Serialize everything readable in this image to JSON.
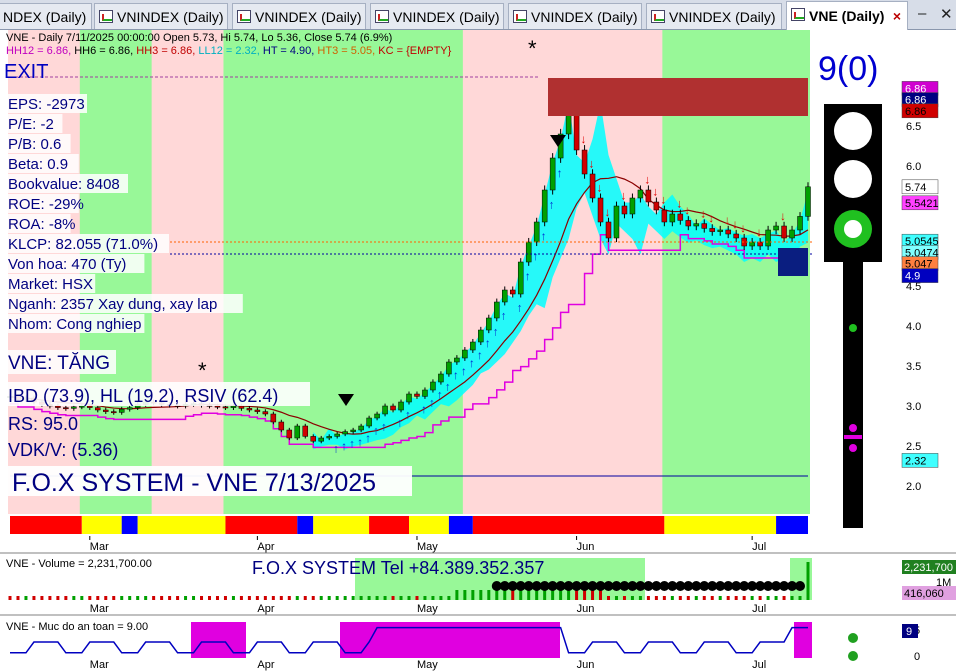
{
  "tabs": [
    {
      "label": "NDEX (Daily)"
    },
    {
      "label": "VNINDEX (Daily)"
    },
    {
      "label": "VNINDEX (Daily)"
    },
    {
      "label": "VNINDEX (Daily)"
    },
    {
      "label": "VNINDEX (Daily)"
    },
    {
      "label": "VNINDEX (Daily)"
    },
    {
      "label": "VNE (Daily)",
      "active": true
    }
  ],
  "header": {
    "line1": "VNE - Daily 7/11/2025 00:00:00 Open 5.73, Hi 5.74, Lo 5.36, Close 5.74 (6.9%)",
    "line2": [
      {
        "text": "HH12 = 6.86, ",
        "color": "#c000c0"
      },
      {
        "text": "HH6 = 6.86, ",
        "color": "#000000"
      },
      {
        "text": "HH3 = 6.86, ",
        "color": "#c00000"
      },
      {
        "text": "LL12 = 2.32, ",
        "color": "#00b0c0"
      },
      {
        "text": "HT = 4.90, ",
        "color": "#000080"
      },
      {
        "text": "HT3 = 5.05, ",
        "color": "#d06000"
      },
      {
        "text": "KC = {EMPTY}",
        "color": "#c00000"
      }
    ]
  },
  "overlay": {
    "exit": "EXIT",
    "fundamentals": [
      "EPS: -2973",
      "P/E: -2",
      "P/B: 0.6",
      "Beta: 0.9",
      "Bookvalue: 8408",
      "ROE: -29%",
      "ROA: -8%",
      "KLCP: 82.055 (71.0%)",
      "Von hoa: 470 (Ty)",
      "Market: HSX",
      "Nganh: 2357 Xay dung, xay lap",
      "Nhom: Cong nghiep"
    ],
    "trend": "VNE: TĂNG",
    "ratings": "IBD (73.9), HL (19.2), RSIV (62.4)",
    "rs": "RS: 95.0",
    "vdk": "VDK/V:  (5.36)",
    "banner": "F.O.X SYSTEM - VNE 7/13/2025",
    "signal": "9(0)",
    "vol_banner": "F.O.X SYSTEM Tel +84.389.352.357"
  },
  "chart_data": [
    {
      "type": "candlestick",
      "name": "VNE",
      "x": [
        "Feb 17",
        "Feb 18",
        "Feb 19",
        "Feb 20",
        "Feb 21",
        "Feb 24",
        "Feb 25",
        "Feb 26",
        "Feb 27",
        "Feb 28",
        "Mar 3",
        "Mar 4",
        "Mar 5",
        "Mar 6",
        "Mar 7",
        "Mar 10",
        "Mar 11",
        "Mar 12",
        "Mar 13",
        "Mar 14",
        "Mar 17",
        "Mar 18",
        "Mar 19",
        "Mar 20",
        "Mar 21",
        "Mar 24",
        "Mar 25",
        "Mar 26",
        "Mar 27",
        "Mar 28",
        "Mar 31",
        "Apr 1",
        "Apr 2",
        "Apr 3",
        "Apr 4",
        "Apr 8",
        "Apr 9",
        "Apr 10",
        "Apr 11",
        "Apr 14",
        "Apr 15",
        "Apr 16",
        "Apr 17",
        "Apr 18",
        "Apr 21",
        "Apr 22",
        "Apr 23",
        "Apr 24",
        "Apr 25",
        "Apr 28",
        "Apr 29",
        "May 5",
        "May 6",
        "May 7",
        "May 8",
        "May 9",
        "May 12",
        "May 13",
        "May 14",
        "May 15",
        "May 16",
        "May 19",
        "May 20",
        "May 21",
        "May 22",
        "May 23",
        "May 26",
        "May 27",
        "May 28",
        "May 29",
        "May 30",
        "Jun 2",
        "Jun 3",
        "Jun 4",
        "Jun 5",
        "Jun 6",
        "Jun 9",
        "Jun 10",
        "Jun 11",
        "Jun 12",
        "Jun 13",
        "Jun 16",
        "Jun 17",
        "Jun 18",
        "Jun 19",
        "Jun 20",
        "Jun 23",
        "Jun 24",
        "Jun 25",
        "Jun 26",
        "Jun 27",
        "Jun 30",
        "Jul 1",
        "Jul 2",
        "Jul 3",
        "Jul 4",
        "Jul 7",
        "Jul 8",
        "Jul 9",
        "Jul 10",
        "Jul 11"
      ],
      "close": [
        3.12,
        3.08,
        3.1,
        3.05,
        3.02,
        3.0,
        2.98,
        2.97,
        2.99,
        3.0,
        2.98,
        2.95,
        2.93,
        2.92,
        2.96,
        2.98,
        3.02,
        3.05,
        3.04,
        3.02,
        3.01,
        3.0,
        3.02,
        3.03,
        3.01,
        3.0,
        2.99,
        2.98,
        3.0,
        2.97,
        2.95,
        2.93,
        2.9,
        2.8,
        2.7,
        2.6,
        2.75,
        2.62,
        2.56,
        2.6,
        2.62,
        2.65,
        2.68,
        2.7,
        2.75,
        2.85,
        2.9,
        3.0,
        2.95,
        3.05,
        3.15,
        3.12,
        3.2,
        3.3,
        3.4,
        3.55,
        3.6,
        3.7,
        3.8,
        3.95,
        4.1,
        4.3,
        4.45,
        4.4,
        4.8,
        5.05,
        5.3,
        5.7,
        6.1,
        6.4,
        6.86,
        6.2,
        5.9,
        5.6,
        5.3,
        5.1,
        5.5,
        5.4,
        5.6,
        5.7,
        5.55,
        5.45,
        5.3,
        5.4,
        5.32,
        5.25,
        5.28,
        5.22,
        5.18,
        5.2,
        5.15,
        5.1,
        5.0,
        5.05,
        5.0,
        5.2,
        5.25,
        5.1,
        5.2,
        5.37,
        5.74
      ],
      "ylim": [
        1.65,
        7.5
      ],
      "yticks": [
        2.0,
        2.5,
        3.0,
        3.5,
        4.0,
        4.5,
        5.0,
        5.5,
        6.0,
        6.5,
        7.0
      ]
    },
    {
      "type": "bar",
      "name": "Volume",
      "label": "VNE - Volume = 2,231,700.00",
      "last_value": "2,231,700",
      "ma_value": "416,060",
      "tick": "1M"
    },
    {
      "type": "line",
      "name": "Muc do an toan",
      "label": "VNE - Muc do an toan = 9.00",
      "last_value": "9",
      "yticks": [
        "5",
        "0"
      ]
    }
  ],
  "months": [
    "Mar",
    "Apr",
    "May",
    "Jun",
    "Jul"
  ],
  "price_badges": [
    {
      "text": "6.86",
      "bg": "#d000d0",
      "fg": "#ffffff",
      "value": 6.97
    },
    {
      "text": "6.86",
      "bg": "#000080",
      "fg": "#ffffff",
      "value": 6.83
    },
    {
      "text": "6.86",
      "bg": "#d00000",
      "fg": "#000000",
      "value": 6.69
    },
    {
      "text": "5.74",
      "bg": "#ffffff",
      "fg": "#000000",
      "value": 5.74
    },
    {
      "text": "5.5421",
      "bg": "#ff40ff",
      "fg": "#000000",
      "value": 5.54
    },
    {
      "text": "5.0545",
      "bg": "#40ffff",
      "fg": "#000000",
      "value": 5.06
    },
    {
      "text": "5.0474",
      "bg": "#80ffff",
      "fg": "#000000",
      "value": 4.92
    },
    {
      "text": "5.047",
      "bg": "#ff8040",
      "fg": "#000000",
      "value": 4.78
    },
    {
      "text": "4.9",
      "bg": "#0000c0",
      "fg": "#ffffff",
      "value": 4.63
    },
    {
      "text": "2.32",
      "bg": "#40ffff",
      "fg": "#000000",
      "value": 2.32
    }
  ],
  "colors": {
    "up": "#00a000",
    "down": "#d00000",
    "shade_green": "#98f898",
    "shade_pink": "#ffd8d8",
    "cyan": "#00ffff",
    "magenta": "#e000e0"
  }
}
